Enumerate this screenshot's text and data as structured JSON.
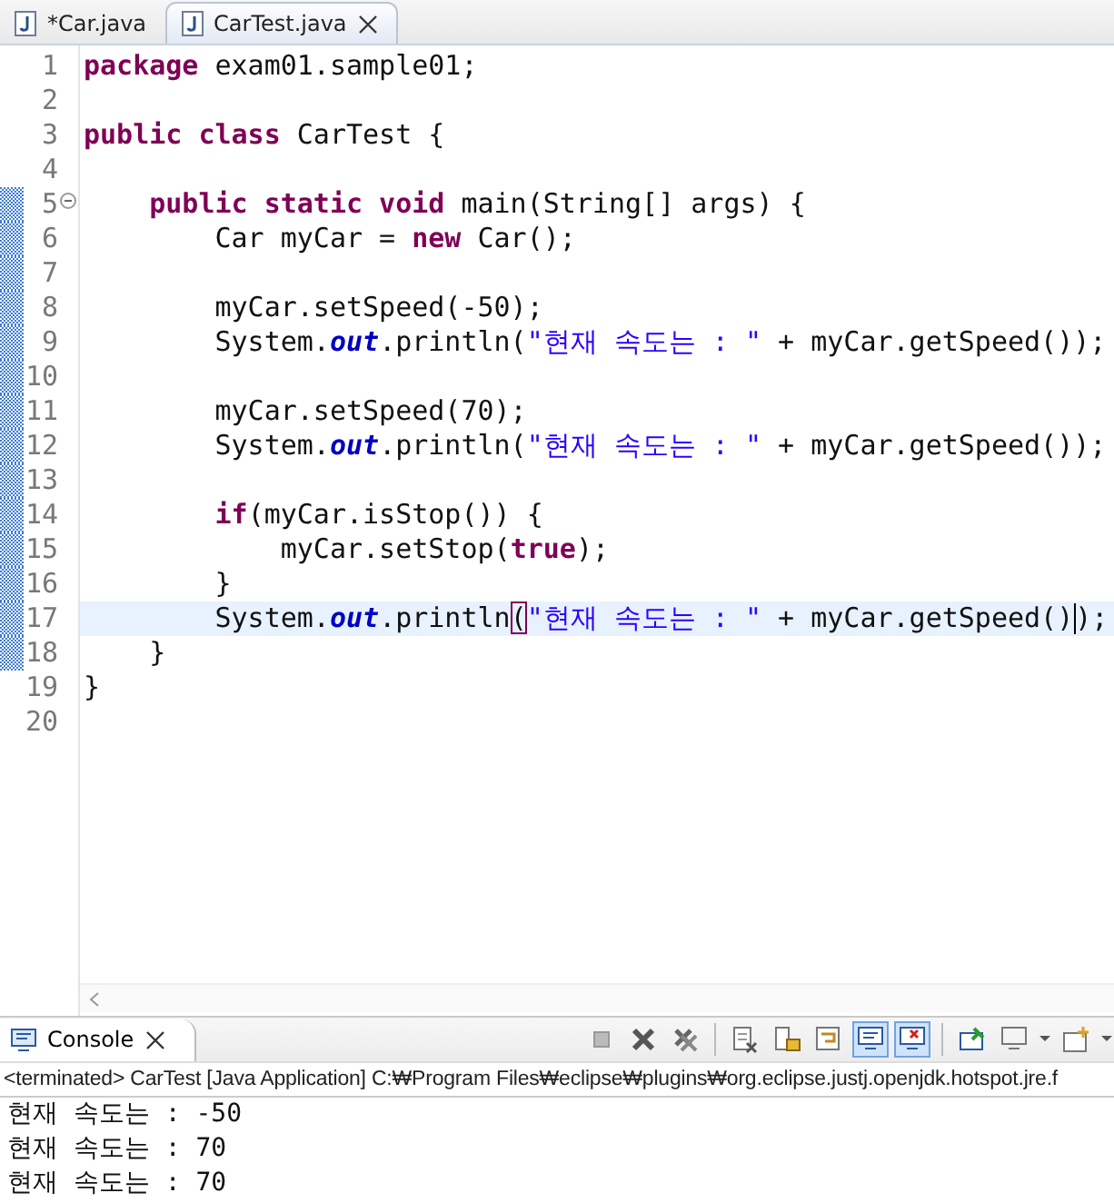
{
  "editor_tabs": [
    {
      "label": "*Car.java",
      "selected": false,
      "closable": false
    },
    {
      "label": "CarTest.java",
      "selected": true,
      "closable": true
    }
  ],
  "code_lines": [
    {
      "number": "1",
      "kind": "plain",
      "current": false,
      "in_range": false,
      "tokens": [
        {
          "kind": "kw",
          "text": "package"
        },
        {
          "kind": "plain",
          "text": " exam01.sample01;"
        }
      ]
    },
    {
      "number": "2",
      "kind": "plain",
      "current": false,
      "in_range": false
    },
    {
      "number": "3",
      "kind": "plain",
      "current": false,
      "in_range": false,
      "tokens": [
        {
          "kind": "kw",
          "text": "public class"
        },
        {
          "kind": "plain",
          "text": " CarTest {"
        }
      ]
    },
    {
      "number": "4",
      "kind": "plain",
      "current": false,
      "in_range": false
    },
    {
      "number": "5",
      "kind": "fold-start",
      "current": false,
      "in_range": true,
      "tokens": [
        {
          "kind": "kw",
          "text": "    public static void"
        },
        {
          "kind": "plain",
          "text": " main(String[] args) {"
        }
      ]
    },
    {
      "number": "6",
      "kind": "plain",
      "current": false,
      "in_range": true,
      "tokens": [
        {
          "kind": "plain",
          "text": "        Car myCar = "
        },
        {
          "kind": "kw",
          "text": "new"
        },
        {
          "kind": "plain",
          "text": " Car();"
        }
      ]
    },
    {
      "number": "7",
      "kind": "plain",
      "current": false,
      "in_range": true
    },
    {
      "number": "8",
      "kind": "plain",
      "current": false,
      "in_range": true,
      "tokens": [
        {
          "kind": "plain",
          "text": "        myCar.setSpeed(-50);"
        }
      ]
    },
    {
      "number": "9",
      "kind": "plain",
      "current": false,
      "in_range": true,
      "tokens": [
        {
          "kind": "plain",
          "text": "        System."
        },
        {
          "kind": "field",
          "text": "out"
        },
        {
          "kind": "plain",
          "text": ".println("
        },
        {
          "kind": "str",
          "text": "\"현재 속도는 : \""
        },
        {
          "kind": "plain",
          "text": " + myCar.getSpeed());"
        }
      ]
    },
    {
      "number": "10",
      "kind": "plain",
      "current": false,
      "in_range": true
    },
    {
      "number": "11",
      "kind": "plain",
      "current": false,
      "in_range": true,
      "tokens": [
        {
          "kind": "plain",
          "text": "        myCar.setSpeed(70);"
        }
      ]
    },
    {
      "number": "12",
      "kind": "plain",
      "current": false,
      "in_range": true,
      "tokens": [
        {
          "kind": "plain",
          "text": "        System."
        },
        {
          "kind": "field",
          "text": "out"
        },
        {
          "kind": "plain",
          "text": ".println("
        },
        {
          "kind": "str",
          "text": "\"현재 속도는 : \""
        },
        {
          "kind": "plain",
          "text": " + myCar.getSpeed());"
        }
      ]
    },
    {
      "number": "13",
      "kind": "plain",
      "current": false,
      "in_range": true
    },
    {
      "number": "14",
      "kind": "plain",
      "current": false,
      "in_range": true,
      "tokens": [
        {
          "kind": "kw",
          "text": "        if"
        },
        {
          "kind": "plain",
          "text": "(myCar.isStop()) {"
        }
      ]
    },
    {
      "number": "15",
      "kind": "plain",
      "current": false,
      "in_range": true,
      "tokens": [
        {
          "kind": "plain",
          "text": "            myCar.setStop("
        },
        {
          "kind": "kw",
          "text": "true"
        },
        {
          "kind": "plain",
          "text": ");"
        }
      ]
    },
    {
      "number": "16",
      "kind": "plain",
      "current": false,
      "in_range": true,
      "tokens": [
        {
          "kind": "plain",
          "text": "        }"
        }
      ]
    },
    {
      "number": "17",
      "kind": "plain",
      "current": true,
      "in_range": true,
      "tokens": [
        {
          "kind": "plain",
          "text": "        System."
        },
        {
          "kind": "field",
          "text": "out"
        },
        {
          "kind": "plain",
          "text": ".println"
        },
        {
          "kind": "match",
          "text": "("
        },
        {
          "kind": "str",
          "text": "\"현재 속도는 : \""
        },
        {
          "kind": "plain",
          "text": " + myCar.getSpeed()"
        },
        {
          "kind": "caret"
        },
        {
          "kind": "plain",
          "text": ");"
        }
      ]
    },
    {
      "number": "18",
      "kind": "plain",
      "current": false,
      "in_range": true,
      "tokens": [
        {
          "kind": "plain",
          "text": "    }"
        }
      ]
    },
    {
      "number": "19",
      "kind": "plain",
      "current": false,
      "in_range": false,
      "tokens": [
        {
          "kind": "plain",
          "text": "}"
        }
      ]
    },
    {
      "number": "20",
      "kind": "plain",
      "current": false,
      "in_range": false
    }
  ],
  "console": {
    "tab": {
      "label": "Console",
      "selected": true
    },
    "toolbar": [
      [
        {
          "kind": "stop",
          "pressed": false,
          "has_menu": false
        },
        {
          "kind": "remove",
          "pressed": false,
          "has_menu": false
        },
        {
          "kind": "remove-all",
          "pressed": false,
          "has_menu": false
        }
      ],
      [
        {
          "kind": "clear",
          "pressed": false,
          "has_menu": false
        },
        {
          "kind": "scroll-lock",
          "pressed": false,
          "has_menu": false
        },
        {
          "kind": "word-wrap",
          "pressed": false,
          "has_menu": false
        },
        {
          "kind": "show-out",
          "pressed": true,
          "has_menu": false
        },
        {
          "kind": "show-err",
          "pressed": true,
          "has_menu": false
        }
      ],
      [
        {
          "kind": "pin",
          "pressed": false,
          "has_menu": false
        },
        {
          "kind": "display",
          "pressed": false,
          "has_menu": true
        },
        {
          "kind": "new",
          "pressed": false,
          "has_menu": true
        }
      ]
    ],
    "header": "<terminated> CarTest [Java Application] C:₩Program Files₩eclipse₩plugins₩org.eclipse.justj.openjdk.hotspot.jre.f",
    "output": [
      "현재 속도는 : -50",
      "현재 속도는 : 70",
      "현재 속도는 : 70"
    ]
  }
}
